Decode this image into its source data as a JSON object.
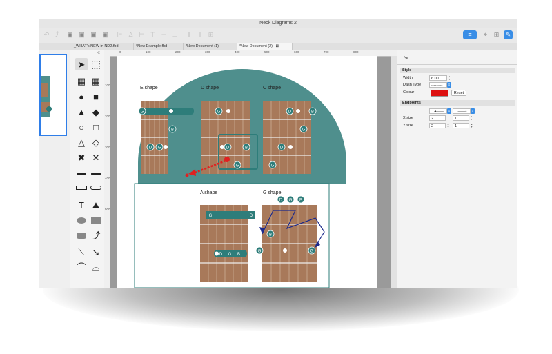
{
  "window": {
    "title": "Neck Diagrams 2"
  },
  "tabs": [
    {
      "label": "_WHAT's NEW in ND2.fbd"
    },
    {
      "label": "*New Example.fbd"
    },
    {
      "label": "*New Document (1)"
    },
    {
      "label": "*New Document (2)"
    }
  ],
  "tab_close_symbol": "⊠",
  "collapse_symbol": "«",
  "ruler": {
    "h_ticks": [
      "0",
      "100",
      "200",
      "300",
      "400",
      "500",
      "600",
      "700",
      "800"
    ],
    "v_ticks": [
      "100",
      "200",
      "300",
      "400",
      "500"
    ]
  },
  "diagrams": {
    "top": [
      {
        "label": "E shape",
        "bar_note": "G",
        "notes": [
          "G",
          "B",
          "D",
          "G"
        ]
      },
      {
        "label": "D shape",
        "notes": [
          "G",
          "D",
          "B",
          "G"
        ]
      },
      {
        "label": "C shape",
        "notes": [
          "D",
          "B",
          "G",
          "D",
          "G"
        ]
      }
    ],
    "bottom": [
      {
        "label": "A shape",
        "bar_notes": [
          "G",
          "D"
        ],
        "notes": [
          "D",
          "G",
          "B"
        ]
      },
      {
        "label": "G shape",
        "notes": [
          "D",
          "G",
          "B",
          "B",
          "G",
          "G"
        ]
      }
    ]
  },
  "colors": {
    "teal": "#2e7d7a",
    "arch": "#4f8f8d",
    "wood": "#a8795a",
    "red_arrow": "#e02020",
    "blue_arrow": "#1c2a8c",
    "accent": "#3a8ee6"
  },
  "inspector": {
    "style_header": "Style",
    "width_label": "Width",
    "width_value": "6.00",
    "dash_label": "Dash Type",
    "dash_value": "---------",
    "colour_label": "Colour",
    "colour_value": "#dd1111",
    "reset_label": "Reset",
    "endpoints_header": "Endpoints",
    "xsize_label": "X size",
    "xsize_a": "2",
    "xsize_b": "1",
    "ysize_label": "Y size",
    "ysize_a": "2",
    "ysize_b": "1"
  }
}
